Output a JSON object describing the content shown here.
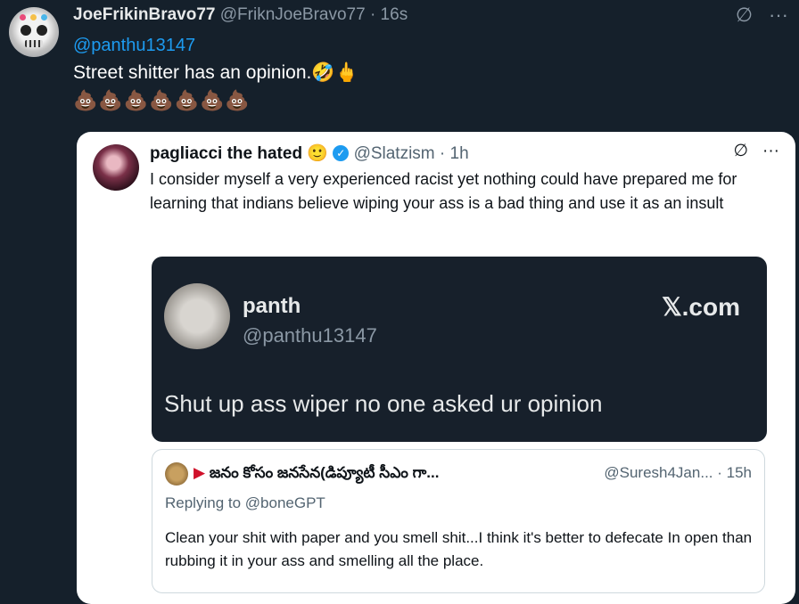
{
  "tweet": {
    "author_name": "JoeFrikinBravo77",
    "author_handle": "@FriknJoeBravo77",
    "time": "· 16s",
    "mention": "@panthu13147",
    "text": "Street shitter has an opinion.🤣🖕",
    "emojis": "💩💩💩💩💩💩💩"
  },
  "header_icons": {
    "grok": "∅",
    "more": "···"
  },
  "quote": {
    "author_name": "pagliacci the hated",
    "author_emoji": "🙂",
    "verified_icon": "✓",
    "author_handle": "@Slatzism",
    "time": "· 1h",
    "text": "I consider myself a very experienced racist yet nothing could have prepared me for learning that indians believe wiping your ass is a bad thing and use it as an insult",
    "icons": {
      "grok": "∅",
      "more": "···"
    }
  },
  "link_card": {
    "name": "panth",
    "handle": "@panthu13147",
    "brand": "𝕏.com",
    "text": "Shut up ass wiper no one asked ur opinion"
  },
  "reply": {
    "flag": "▶",
    "author_name": "జనం కోసం జనసేన(డిప్యూటీ సీఎం గా...",
    "author_handle": "@Suresh4Jan...",
    "time": "· 15h",
    "replying_to": "Replying to @boneGPT",
    "text": "Clean your shit with paper and you smell shit...I think it's better to defecate In open than rubbing it in your ass and smelling all the place."
  }
}
